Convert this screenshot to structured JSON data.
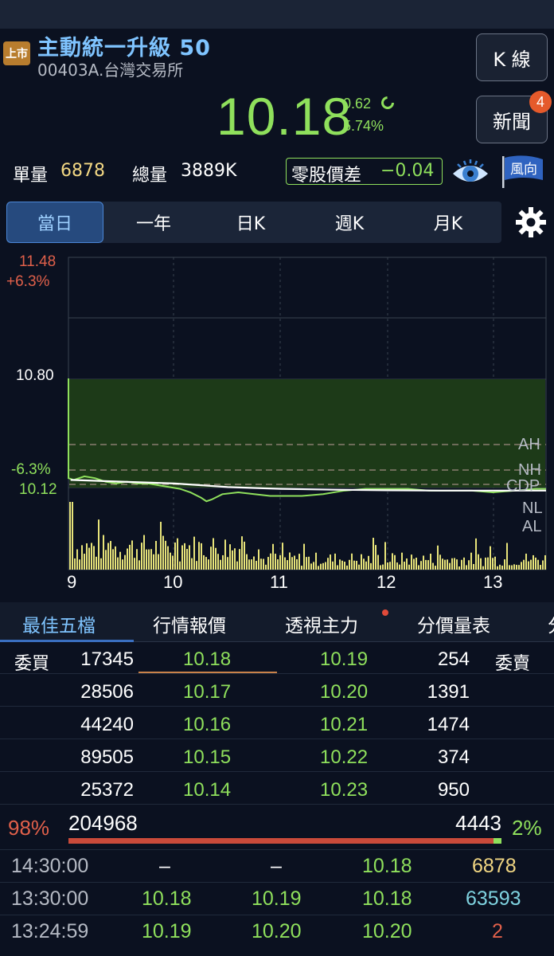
{
  "header": {
    "market_badge": "上市",
    "title": "主動統一升級 50",
    "subtitle": "00403A.台灣交易所",
    "kline_button": "K 線",
    "news_button": "新聞",
    "news_count": "4",
    "price": "10.18",
    "change": "0.62",
    "change_pct": "5.74%",
    "trend_icon": "down-arrow-icon",
    "single_vol_label": "單量",
    "single_vol": "6878",
    "total_vol_label": "總量",
    "total_vol": "3889K",
    "odd_lot_label": "零股價差",
    "odd_lot_value": "−0.04",
    "eye_icon": "eye-icon",
    "flag_label": "風向"
  },
  "tabs": [
    {
      "label": "當日",
      "active": true
    },
    {
      "label": "一年",
      "active": false
    },
    {
      "label": "日K",
      "active": false
    },
    {
      "label": "週K",
      "active": false
    },
    {
      "label": "月K",
      "active": false
    }
  ],
  "chart": {
    "y_top_price": "11.48",
    "y_top_pct": "+6.3%",
    "y_mid_price": "10.80",
    "y_bottom_pct": "-6.3%",
    "y_bottom_price": "10.12",
    "x_labels": [
      "9",
      "10",
      "11",
      "12",
      "13"
    ],
    "ref_labels": [
      "AH",
      "NH",
      "CDP",
      "NL",
      "AL"
    ]
  },
  "chart_data": {
    "type": "line",
    "title": "",
    "x_label": "",
    "y_label": "",
    "ylim": [
      10.12,
      11.48
    ],
    "x_ticks": [
      "9",
      "10",
      "11",
      "12",
      "13"
    ],
    "series": [
      {
        "x": [
          9.0,
          9.25,
          9.5,
          9.75,
          10.0,
          10.25,
          10.5,
          10.75,
          11.0,
          11.25,
          11.5,
          11.75,
          12.0,
          12.25,
          12.5,
          12.75,
          13.0,
          13.25,
          13.5
        ],
        "y": [
          10.8,
          10.24,
          10.23,
          10.22,
          10.22,
          10.16,
          10.16,
          10.15,
          10.15,
          10.16,
          10.17,
          10.18,
          10.18,
          10.18,
          10.17,
          10.17,
          10.17,
          10.17,
          10.18
        ]
      }
    ]
  },
  "sub_tabs": [
    {
      "label": "最佳五檔",
      "active": true
    },
    {
      "label": "行情報價",
      "active": false
    },
    {
      "label": "透視主力",
      "active": false
    },
    {
      "label": "分價量表",
      "active": false
    },
    {
      "label": "分",
      "active": false
    }
  ],
  "orderbook": {
    "bid_label": "委買",
    "ask_label": "委賣",
    "rows": [
      {
        "bid_qty": "17345",
        "bid_px": "10.18",
        "ask_px": "10.19",
        "ask_qty": "254"
      },
      {
        "bid_qty": "28506",
        "bid_px": "10.17",
        "ask_px": "10.20",
        "ask_qty": "1391"
      },
      {
        "bid_qty": "44240",
        "bid_px": "10.16",
        "ask_px": "10.21",
        "ask_qty": "1474"
      },
      {
        "bid_qty": "89505",
        "bid_px": "10.15",
        "ask_px": "10.22",
        "ask_qty": "374"
      },
      {
        "bid_qty": "25372",
        "bid_px": "10.14",
        "ask_px": "10.23",
        "ask_qty": "950"
      }
    ],
    "buy_pct": "98%",
    "buy_total": "204968",
    "sell_total": "4443",
    "sell_pct": "2%"
  },
  "trades": [
    {
      "time": "14:30:00",
      "bid": "–",
      "ask": "–",
      "price": "10.18",
      "qty": "6878"
    },
    {
      "time": "13:30:00",
      "bid": "10.18",
      "ask": "10.19",
      "price": "10.18",
      "qty": "63593"
    },
    {
      "time": "13:24:59",
      "bid": "10.19",
      "ask": "10.20",
      "price": "10.20",
      "qty": "2"
    }
  ]
}
